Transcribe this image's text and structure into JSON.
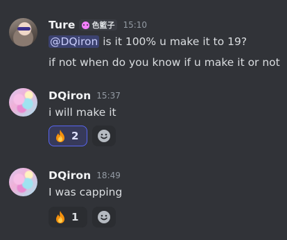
{
  "messages": [
    {
      "username": "Ture",
      "tag": "色籃子",
      "time": "15:10",
      "mention": "@DQiron",
      "lines": [
        "is it 100% u make it to 19?",
        "if not when do you know if u make it or not"
      ]
    },
    {
      "username": "DQiron",
      "time": "15:37",
      "lines": [
        "i will make it"
      ],
      "reaction": {
        "emoji": "fire",
        "count": "2",
        "self_reacted": true
      }
    },
    {
      "username": "DQiron",
      "time": "18:49",
      "lines": [
        "I was capping"
      ],
      "reaction": {
        "emoji": "fire",
        "count": "1",
        "self_reacted": false
      }
    }
  ],
  "colors": {
    "background": "#313338",
    "mention_bg": "#3c4270",
    "reaction_selected_border": "#5865f2",
    "tag_icon": "#f47fff"
  }
}
